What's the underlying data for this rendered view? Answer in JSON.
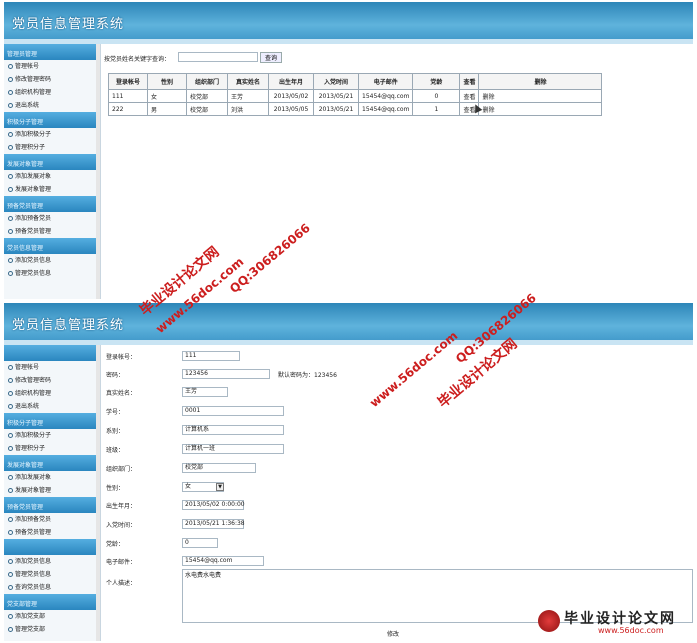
{
  "app_title": "党员信息管理系统",
  "sidebar1": [
    {
      "header": "管理员管理",
      "items": [
        "管理帐号",
        "修改管理密码",
        "组织机构管理",
        "退出系统"
      ]
    },
    {
      "header": "积极分子管理",
      "items": [
        "添加积极分子",
        "管理积分子"
      ]
    },
    {
      "header": "发展对象管理",
      "items": [
        "添加发展对象",
        "发展对象管理"
      ]
    },
    {
      "header": "预备党员管理",
      "items": [
        "添加预备党员",
        "预备党员管理"
      ]
    },
    {
      "header": "党员信息管理",
      "items": [
        "添加党员信息",
        "管理党员信息"
      ]
    }
  ],
  "sidebar2": [
    {
      "header": "",
      "items": [
        "管理帐号",
        "修改管理密码",
        "组织机构管理",
        "退出系统"
      ]
    },
    {
      "header": "积极分子管理",
      "items": [
        "添加积极分子",
        "管理积分子"
      ]
    },
    {
      "header": "发展对象管理",
      "items": [
        "添加发展对象",
        "发展对象管理"
      ]
    },
    {
      "header": "预备党员管理",
      "items": [
        "添加预备党员",
        "预备党员管理"
      ]
    },
    {
      "header": "",
      "items": [
        "添加党员信息",
        "管理党员信息",
        "查询党员信息"
      ]
    },
    {
      "header": "党支部管理",
      "items": [
        "添加党支部",
        "管理党支部"
      ]
    }
  ],
  "search": {
    "label": "按党员姓名关键字查询：",
    "button": "查询"
  },
  "table": {
    "headers": [
      "登录帐号",
      "性别",
      "组织部门",
      "真实姓名",
      "出生年月",
      "入党时间",
      "电子邮件",
      "党龄",
      "查看",
      "删除"
    ],
    "rows": [
      [
        "111",
        "女",
        "校党部",
        "王芳",
        "2013/05/02",
        "2013/05/21",
        "15454@qq.com",
        "0",
        "查看",
        "删除"
      ],
      [
        "222",
        "男",
        "校党部",
        "刘洪",
        "2013/05/05",
        "2013/05/21",
        "15454@qq.com",
        "1",
        "查看",
        "删除"
      ]
    ]
  },
  "form": {
    "fields": [
      {
        "label": "登录帐号：",
        "value": "111"
      },
      {
        "label": "密码：",
        "value": "123456",
        "note": "默认密码为：123456"
      },
      {
        "label": "真实姓名：",
        "value": "王芳"
      },
      {
        "label": "学号：",
        "value": "0001"
      },
      {
        "label": "系别：",
        "value": "计算机系"
      },
      {
        "label": "班级：",
        "value": "计算机一班"
      },
      {
        "label": "组织部门：",
        "value": "校党部"
      },
      {
        "label": "性别：",
        "value": "女"
      },
      {
        "label": "出生年月：",
        "value": "2013/05/02 0:00:00"
      },
      {
        "label": "入党时间：",
        "value": "2013/05/21 1:36:38"
      },
      {
        "label": "党龄：",
        "value": "0"
      },
      {
        "label": "电子邮件：",
        "value": "15454@qq.com"
      },
      {
        "label": "个人描述：",
        "value": "水电费水电费"
      }
    ],
    "submit": "修改"
  },
  "watermarks": {
    "site": "毕业设计论文网",
    "url": "www.56doc.com",
    "qq": "QQ:306826066",
    "brand_cn": "毕业设计论文网",
    "brand_url": "www.56doc.com"
  },
  "colors": {
    "header": "#3a93c6",
    "group": "#2a86bf",
    "watermark": "#cc1e1e"
  }
}
